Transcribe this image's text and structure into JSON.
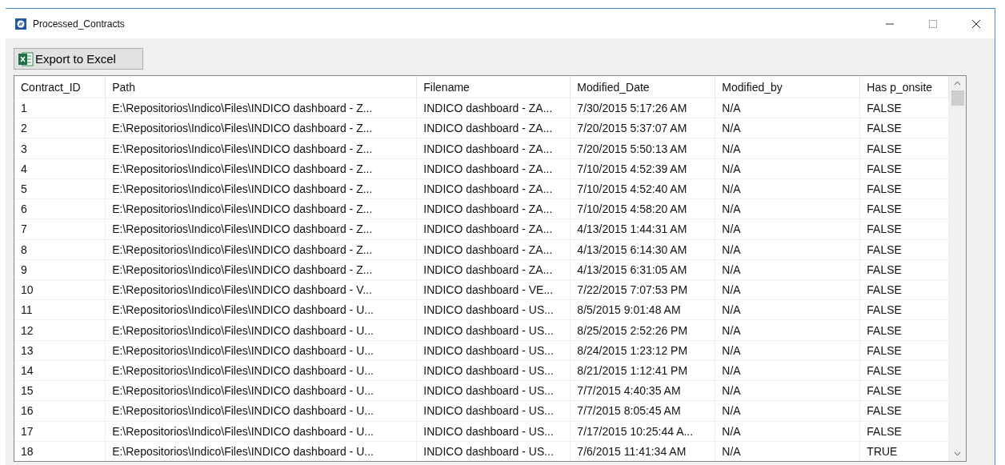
{
  "window": {
    "title": "Processed_Contracts"
  },
  "toolbar": {
    "export_button": "Export to Excel"
  },
  "table": {
    "columns": [
      "Contract_ID",
      "Path",
      "Filename",
      "Modified_Date",
      "Modified_by",
      "Has p_onsite"
    ],
    "rows": [
      [
        "1",
        "E:\\Repositorios\\Indico\\Files\\INDICO dashboard - Z...",
        "INDICO dashboard - ZA...",
        "7/30/2015 5:17:26 AM",
        "N/A",
        "FALSE"
      ],
      [
        "2",
        "E:\\Repositorios\\Indico\\Files\\INDICO dashboard - Z...",
        "INDICO dashboard - ZA...",
        "7/20/2015 5:37:07 AM",
        "N/A",
        "FALSE"
      ],
      [
        "3",
        "E:\\Repositorios\\Indico\\Files\\INDICO dashboard - Z...",
        "INDICO dashboard - ZA...",
        "7/20/2015 5:50:13 AM",
        "N/A",
        "FALSE"
      ],
      [
        "4",
        "E:\\Repositorios\\Indico\\Files\\INDICO dashboard - Z...",
        "INDICO dashboard - ZA...",
        "7/10/2015 4:52:39 AM",
        "N/A",
        "FALSE"
      ],
      [
        "5",
        "E:\\Repositorios\\Indico\\Files\\INDICO dashboard - Z...",
        "INDICO dashboard - ZA...",
        "7/10/2015 4:52:40 AM",
        "N/A",
        "FALSE"
      ],
      [
        "6",
        "E:\\Repositorios\\Indico\\Files\\INDICO dashboard - Z...",
        "INDICO dashboard - ZA...",
        "7/10/2015 4:58:20 AM",
        "N/A",
        "FALSE"
      ],
      [
        "7",
        "E:\\Repositorios\\Indico\\Files\\INDICO dashboard - Z...",
        "INDICO dashboard - ZA...",
        "4/13/2015 1:44:31 AM",
        "N/A",
        "FALSE"
      ],
      [
        "8",
        "E:\\Repositorios\\Indico\\Files\\INDICO dashboard - Z...",
        "INDICO dashboard - ZA...",
        "4/13/2015 6:14:30 AM",
        "N/A",
        "FALSE"
      ],
      [
        "9",
        "E:\\Repositorios\\Indico\\Files\\INDICO dashboard - Z...",
        "INDICO dashboard - ZA...",
        "4/13/2015 6:31:05 AM",
        "N/A",
        "FALSE"
      ],
      [
        "10",
        "E:\\Repositorios\\Indico\\Files\\INDICO dashboard - V...",
        "INDICO dashboard - VE...",
        "7/22/2015 7:07:53 PM",
        "N/A",
        "FALSE"
      ],
      [
        "11",
        "E:\\Repositorios\\Indico\\Files\\INDICO dashboard - U...",
        "INDICO dashboard - US...",
        "8/5/2015 9:01:48 AM",
        "N/A",
        "FALSE"
      ],
      [
        "12",
        "E:\\Repositorios\\Indico\\Files\\INDICO dashboard - U...",
        "INDICO dashboard - US...",
        "8/25/2015 2:52:26 PM",
        "N/A",
        "FALSE"
      ],
      [
        "13",
        "E:\\Repositorios\\Indico\\Files\\INDICO dashboard - U...",
        "INDICO dashboard - US...",
        "8/24/2015 1:23:12 PM",
        "N/A",
        "FALSE"
      ],
      [
        "14",
        "E:\\Repositorios\\Indico\\Files\\INDICO dashboard - U...",
        "INDICO dashboard - US...",
        "8/21/2015 1:12:41 PM",
        "N/A",
        "FALSE"
      ],
      [
        "15",
        "E:\\Repositorios\\Indico\\Files\\INDICO dashboard - U...",
        "INDICO dashboard - US...",
        "7/7/2015 4:40:35 AM",
        "N/A",
        "FALSE"
      ],
      [
        "16",
        "E:\\Repositorios\\Indico\\Files\\INDICO dashboard - U...",
        "INDICO dashboard - US...",
        "7/7/2015 8:05:45 AM",
        "N/A",
        "FALSE"
      ],
      [
        "17",
        "E:\\Repositorios\\Indico\\Files\\INDICO dashboard - U...",
        "INDICO dashboard - US...",
        "7/17/2015 10:25:44 A...",
        "N/A",
        "FALSE"
      ],
      [
        "18",
        "E:\\Repositorios\\Indico\\Files\\INDICO dashboard - U...",
        "INDICO dashboard - US...",
        "7/6/2015 11:41:34 AM",
        "N/A",
        "TRUE"
      ]
    ]
  }
}
